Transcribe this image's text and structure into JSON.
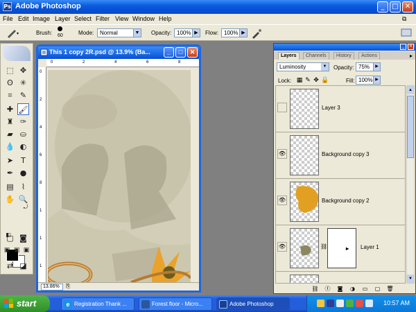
{
  "app": {
    "title": "Adobe Photoshop",
    "logo": "Ps"
  },
  "window_buttons": {
    "minimize": "_",
    "maximize": "□",
    "close": "✕"
  },
  "menu": [
    "File",
    "Edit",
    "Image",
    "Layer",
    "Select",
    "Filter",
    "View",
    "Window",
    "Help"
  ],
  "options_bar": {
    "brush_label": "Brush:",
    "brush_size": "60",
    "mode_label": "Mode:",
    "mode_value": "Normal",
    "opacity_label": "Opacity:",
    "opacity_value": "100%",
    "flow_label": "Flow:",
    "flow_value": "100%"
  },
  "document": {
    "title": "This 1 copy 2R.psd @ 13.9% (Ba...",
    "zoom": "13.86%",
    "ruler_top": [
      "0",
      "2",
      "4",
      "6",
      "8"
    ],
    "ruler_left": [
      "0",
      "2",
      "4",
      "6",
      "8",
      "1",
      "1",
      "1"
    ]
  },
  "layers_panel": {
    "tabs": [
      "Layers",
      "Channels",
      "History",
      "Actions"
    ],
    "blend_mode": "Luminosity",
    "opacity_label": "Opacity:",
    "opacity_value": "75%",
    "lock_label": "Lock:",
    "fill_label": "Fill:",
    "fill_value": "100%",
    "layers": [
      {
        "name": "Layer 3",
        "visible": false
      },
      {
        "name": "Background copy 3",
        "visible": true
      },
      {
        "name": "Background copy 2",
        "visible": true
      },
      {
        "name": "Layer 1",
        "visible": true
      }
    ]
  },
  "taskbar": {
    "start": "start",
    "tasks": [
      {
        "label": "Registration Thank ...",
        "icon": "ie-icon"
      },
      {
        "label": "Forest floor - Micro...",
        "icon": "word-icon"
      },
      {
        "label": "Adobe Photoshop",
        "icon": "photoshop-icon"
      }
    ],
    "clock": "10:57 AM"
  },
  "colors": {
    "xp_blue": "#0a5ddf",
    "chrome": "#ece9d8",
    "canvas_bg": "#d2cdb6",
    "accent_orange": "#e2a022"
  }
}
